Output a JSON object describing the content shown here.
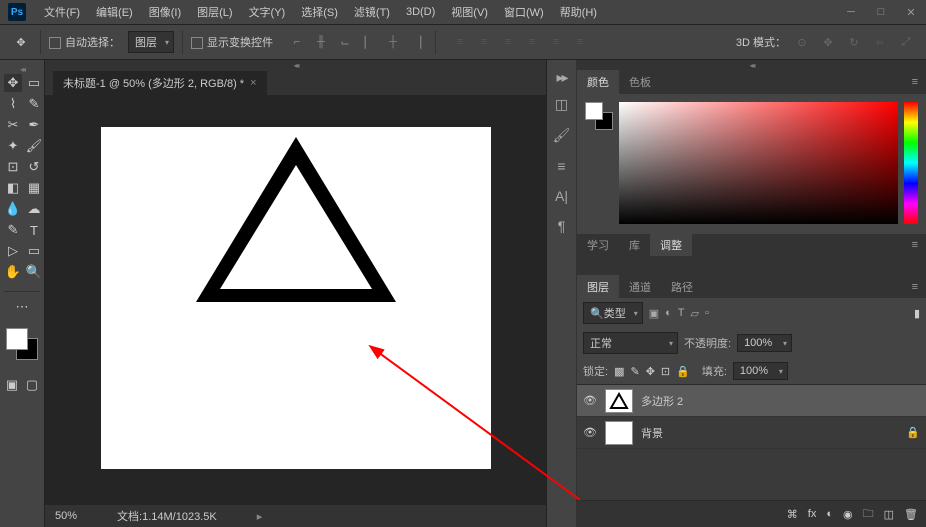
{
  "menu": {
    "file": "文件(F)",
    "edit": "编辑(E)",
    "image": "图像(I)",
    "layer": "图层(L)",
    "type": "文字(Y)",
    "select": "选择(S)",
    "filter": "滤镜(T)",
    "threeD": "3D(D)",
    "view": "视图(V)",
    "window": "窗口(W)",
    "help": "帮助(H)"
  },
  "toolbar": {
    "autoSelect": "自动选择：",
    "layerDrop": "图层",
    "showTransform": "显示变换控件",
    "mode3d": "3D 模式："
  },
  "doc": {
    "tab": "未标题-1 @ 50% (多边形 2, RGB/8) *"
  },
  "status": {
    "zoom": "50%",
    "docinfo": "文档:1.14M/1023.5K"
  },
  "colorPanel": {
    "tab1": "颜色",
    "tab2": "色板"
  },
  "midTabs": {
    "t1": "学习",
    "t2": "库",
    "t3": "调整"
  },
  "layerTabs": {
    "t1": "图层",
    "t2": "通道",
    "t3": "路径"
  },
  "layerPanel": {
    "kind": "类型",
    "blend": "正常",
    "opacityLbl": "不透明度:",
    "opacity": "100%",
    "lockLbl": "锁定:",
    "fillLbl": "填充:",
    "fill": "100%",
    "layer1": "多边形 2",
    "layer2": "背景"
  }
}
